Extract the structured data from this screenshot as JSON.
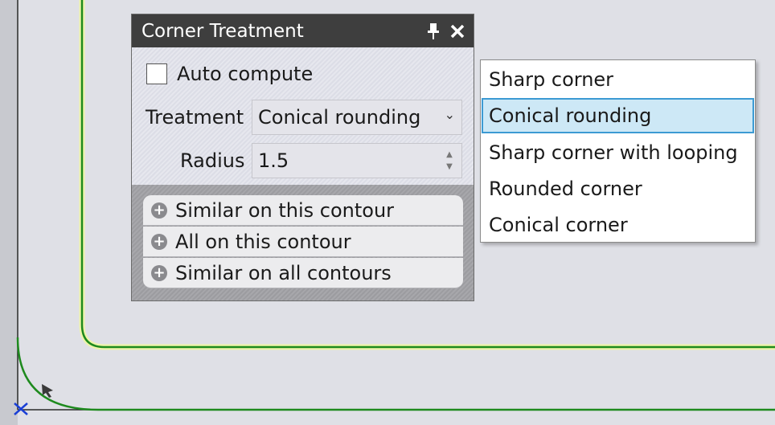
{
  "colors": {
    "canvas_bg": "#dfe0e6",
    "contour_green": "#1e8a1e",
    "highlight_yellow": "#e8f0a0",
    "selection_fill": "#cde8f6",
    "selection_border": "#3c9ad3",
    "origin_marker": "#1a3fd6"
  },
  "panel": {
    "title": "Corner Treatment",
    "pin_icon": "pin-icon",
    "close_icon": "close-icon",
    "auto_compute": {
      "label": "Auto compute",
      "checked": false
    },
    "treatment": {
      "label": "Treatment",
      "value": "Conical rounding"
    },
    "radius": {
      "label": "Radius",
      "value": "1.5"
    },
    "actions": [
      {
        "label": "Similar on this contour",
        "icon": "plus-circle-icon"
      },
      {
        "label": "All on this contour",
        "icon": "plus-circle-icon"
      },
      {
        "label": "Similar on all contours",
        "icon": "plus-circle-icon"
      }
    ]
  },
  "dropdown": {
    "options": [
      "Sharp corner",
      "Conical rounding",
      "Sharp corner with looping",
      "Rounded corner",
      "Conical corner"
    ],
    "selected_index": 1
  }
}
